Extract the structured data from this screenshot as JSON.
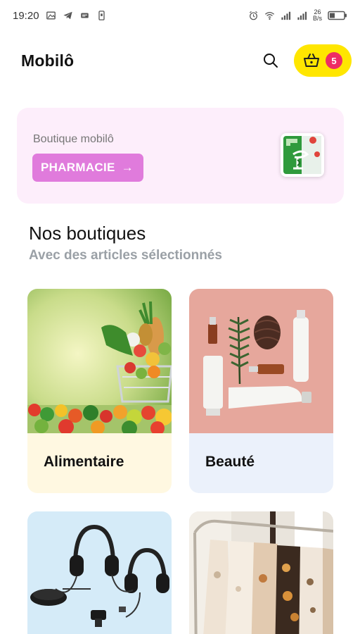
{
  "status_bar": {
    "time": "19:20",
    "speed_value": "26",
    "speed_unit": "B/s"
  },
  "header": {
    "brand": "Mobilô",
    "cart_count": "5",
    "accent_color": "#ffe600",
    "badge_color": "#ee2c64"
  },
  "promo": {
    "subtitle": "Boutique mobilô",
    "button_label": "PHARMACIE",
    "button_arrow": "→",
    "background": "#fdeefb",
    "button_color": "#e07bdc"
  },
  "section": {
    "title": "Nos boutiques",
    "subtitle": "Avec des articles sélectionnés"
  },
  "shops": [
    {
      "label": "Alimentaire",
      "label_bg": "#fff8e1",
      "image": "grocery-cart-image"
    },
    {
      "label": "Beauté",
      "label_bg": "#ebf1fb",
      "image": "cosmetics-image"
    },
    {
      "label": "",
      "image": "headphones-image"
    },
    {
      "label": "",
      "image": "clothing-rack-image"
    }
  ]
}
